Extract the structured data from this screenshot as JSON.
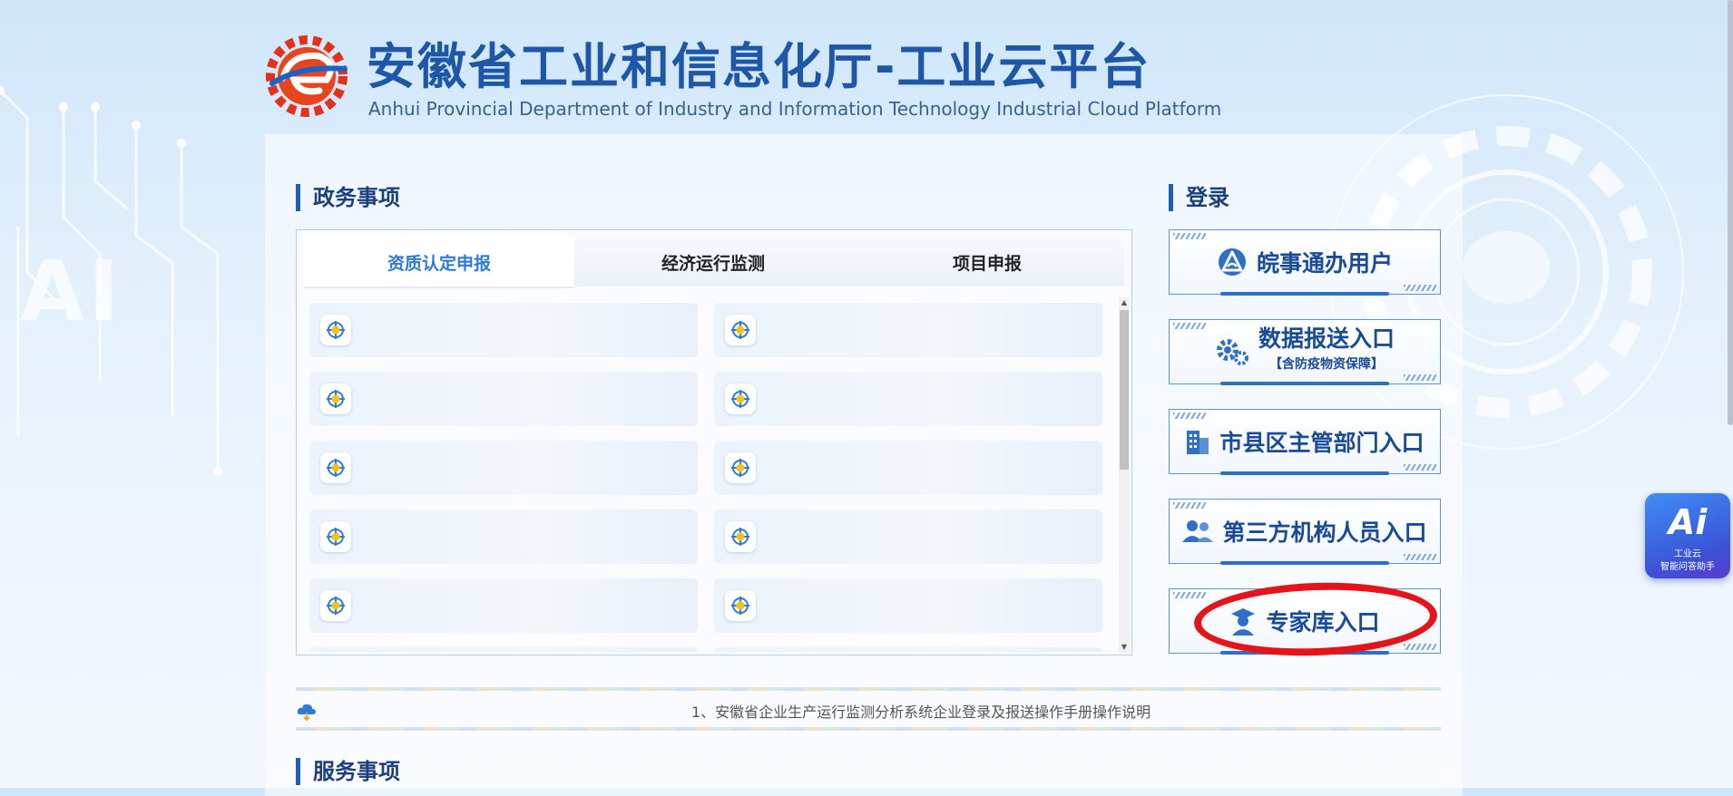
{
  "header": {
    "title_cn": "安徽省工业和信息化厅-工业云平台",
    "title_en": "Anhui Provincial Department of Industry and Information Technology Industrial Cloud Platform"
  },
  "background": {
    "ai_text": "AI"
  },
  "gov_section": {
    "title": "政务事项",
    "tabs": [
      {
        "label": "资质认定申报",
        "active": true
      },
      {
        "label": "经济运行监测",
        "active": false
      },
      {
        "label": "项目申报",
        "active": false
      }
    ],
    "items": [
      "",
      "",
      "",
      "",
      "",
      "",
      "",
      "",
      "",
      "",
      "",
      ""
    ]
  },
  "login_section": {
    "title": "登录",
    "buttons": [
      {
        "label": "皖事通办用户",
        "icon": "wanshitong-icon"
      },
      {
        "label": "数据报送入口",
        "sub": "【含防疫物资保障】",
        "icon": "gears-icon"
      },
      {
        "label": "市县区主管部门入口",
        "icon": "building-icon"
      },
      {
        "label": "第三方机构人员入口",
        "icon": "users-icon"
      },
      {
        "label": "专家库入口",
        "icon": "graduate-icon"
      }
    ]
  },
  "notice": {
    "text": "1、安徽省企业生产运行监测分析系统企业登录及报送操作手册操作说明"
  },
  "service_section": {
    "title": "服务事项"
  },
  "ai_assistant": {
    "logo": "Ai",
    "line1": "工业云",
    "line2": "智能问答助手"
  },
  "colors": {
    "primary": "#1e56a8",
    "accent": "#2f7ad0",
    "annotation_red": "#e5141a"
  }
}
